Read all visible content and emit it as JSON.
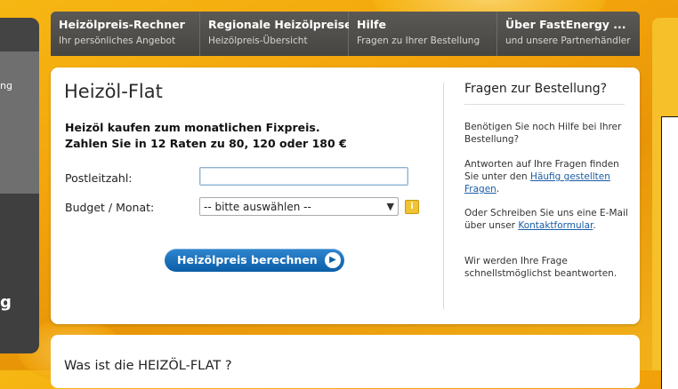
{
  "nav": [
    {
      "title": "Heizölpreis-Rechner",
      "sub": "Ihr persönliches Angebot"
    },
    {
      "title": "Regionale Heizölpreise",
      "sub": "Heizölpreis-Übersicht"
    },
    {
      "title": "Hilfe",
      "sub": "Fragen zu Ihrer Bestellung"
    },
    {
      "title": "Über FastEnergy ...",
      "sub": "und unsere Partnerhändler"
    }
  ],
  "left_panel": {
    "label": "ng",
    "glyph": "g"
  },
  "main": {
    "title": "Heizöl-Flat",
    "intro_line1": "Heizöl kaufen zum monatlichen Fixpreis.",
    "intro_line2": "Zahlen Sie in 12 Raten zu 80, 120 oder 180 €",
    "plz_label": "Postleitzahl:",
    "plz_value": "",
    "budget_label": "Budget / Monat:",
    "budget_selected": "-- bitte auswählen --",
    "button_label": "Heizölpreis berechnen"
  },
  "sidebar": {
    "title": "Fragen zur Bestellung?",
    "p1": "Benötigen Sie noch Hilfe bei Ihrer Bestellung?",
    "p2_text": "Antworten auf Ihre Fragen finden Sie unter den ",
    "p2_link": "Häufig gestellten Fragen",
    "p2_end": ".",
    "p3_text": "Oder Schreiben Sie uns eine E-Mail über unser ",
    "p3_link": "Kontaktformular",
    "p3_end": ".",
    "p4": "Wir werden Ihre Frage schnellstmöglichst beantworten."
  },
  "lower": {
    "heading": "Was ist die HEIZÖL-FLAT ?"
  },
  "colors": {
    "accent_blue": "#0b5ea8",
    "nav_bg": "#4b4a47",
    "page_bg": "#f3a40c"
  }
}
